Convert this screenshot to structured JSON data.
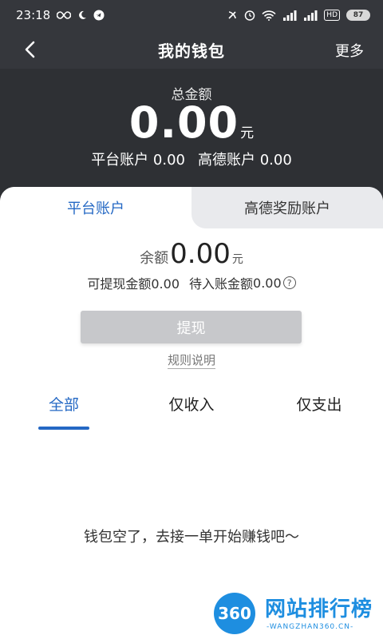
{
  "status_bar": {
    "time": "23:18",
    "left_icons": [
      "infinity-icon",
      "moon-icon",
      "telegram-icon"
    ],
    "right_icons": [
      "nfc-icon",
      "alarm-icon",
      "wifi-icon",
      "signal-1-icon",
      "signal-2-icon",
      "hd-icon"
    ],
    "hd_badge": "HD",
    "battery": "87"
  },
  "nav": {
    "title": "我的钱包",
    "more": "更多",
    "back_icon": "chevron-left-icon"
  },
  "header": {
    "total_label": "总金额",
    "total_amount": "0.00",
    "total_unit": "元",
    "platform_label": "平台账户",
    "platform_amount": "0.00",
    "amap_label": "高德账户",
    "amap_amount": "0.00"
  },
  "account_tabs": {
    "platform": "平台账户",
    "amap_reward": "高德奖励账户"
  },
  "balance": {
    "label": "余额",
    "amount": "0.00",
    "unit": "元",
    "withdrawable_label": "可提现金额",
    "withdrawable_amount": "0.00",
    "pending_label": "待入账金额",
    "pending_amount": "0.00"
  },
  "actions": {
    "withdraw": "提现",
    "rules": "规则说明"
  },
  "filter_tabs": [
    "全部",
    "仅收入",
    "仅支出"
  ],
  "empty_message": "钱包空了，去接一单开始赚钱吧～",
  "watermark": {
    "logo": "360",
    "title": "网站排行榜",
    "subtitle": "-WANGZHAN360.CN-"
  },
  "colors": {
    "accent": "#2468c4",
    "header_bg": "#2e3034",
    "button_disabled": "#c7c8cb"
  }
}
